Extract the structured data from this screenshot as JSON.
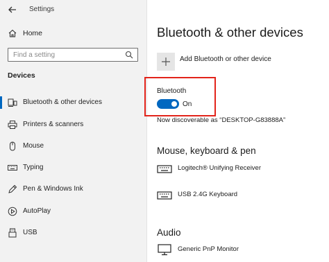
{
  "window": {
    "title": "Settings"
  },
  "sidebar": {
    "home_label": "Home",
    "search_placeholder": "Find a setting",
    "section_label": "Devices",
    "items": [
      {
        "label": "Bluetooth & other devices",
        "icon": "bluetooth-devices-icon",
        "active": true
      },
      {
        "label": "Printers & scanners",
        "icon": "printer-icon",
        "active": false
      },
      {
        "label": "Mouse",
        "icon": "mouse-icon",
        "active": false
      },
      {
        "label": "Typing",
        "icon": "keyboard-icon",
        "active": false
      },
      {
        "label": "Pen & Windows Ink",
        "icon": "pen-icon",
        "active": false
      },
      {
        "label": "AutoPlay",
        "icon": "autoplay-icon",
        "active": false
      },
      {
        "label": "USB",
        "icon": "usb-icon",
        "active": false
      }
    ]
  },
  "main": {
    "title": "Bluetooth & other devices",
    "add_device_label": "Add Bluetooth or other device",
    "bluetooth": {
      "label": "Bluetooth",
      "state": "On",
      "on": true
    },
    "discoverable_text": "Now discoverable as “DESKTOP-G83888A”",
    "sections": [
      {
        "title": "Mouse, keyboard & pen",
        "devices": [
          {
            "name": "Logitech® Unifying Receiver",
            "icon": "keyboard-icon"
          },
          {
            "name": "USB 2.4G Keyboard",
            "icon": "keyboard-icon"
          }
        ]
      },
      {
        "title": "Audio",
        "devices": [
          {
            "name": "Generic PnP Monitor",
            "icon": "monitor-icon"
          }
        ]
      }
    ]
  },
  "colors": {
    "accent": "#0067c0",
    "highlight_border": "#e2231a",
    "sidebar_bg": "#f2f2f2"
  }
}
